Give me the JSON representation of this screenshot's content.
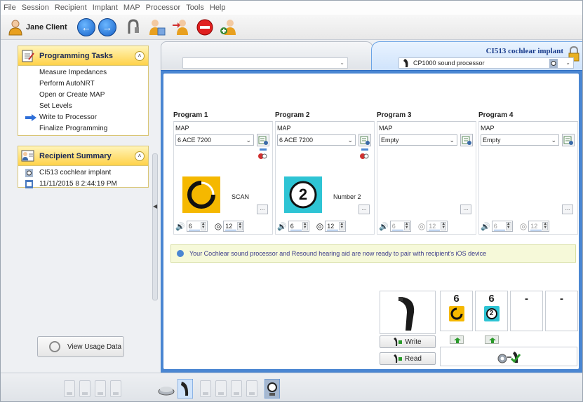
{
  "menu": [
    "File",
    "Session",
    "Recipient",
    "Implant",
    "MAP",
    "Processor",
    "Tools",
    "Help"
  ],
  "toolbar": {
    "client_name": "Jane Client",
    "icons": [
      "person-icon",
      "back-icon",
      "forward-icon",
      "headset-icon",
      "user-check-icon",
      "user-transfer-icon",
      "stop-icon",
      "user-plus-icon"
    ]
  },
  "tasks_panel": {
    "title": "Programming Tasks",
    "items": [
      "Measure Impedances",
      "Perform AutoNRT",
      "Open or Create MAP",
      "Set Levels",
      "Write to Processor",
      "Finalize Programming"
    ],
    "current": "Write to Processor"
  },
  "summary_panel": {
    "title": "Recipient Summary",
    "implant": "CI513 cochlear implant",
    "datetime": "11/11/2015 8 2:44:19 PM"
  },
  "usage_button": "View Usage Data",
  "tabs": {
    "left_combo_value": "",
    "implant_title": "CI513 cochlear implant",
    "processor": "CP1000 sound processor"
  },
  "programs": [
    {
      "title": "Program 1",
      "map_label": "MAP",
      "map": "6 ACE 7200",
      "badge_type": "scan",
      "badge_color": "#f5b800",
      "name": "SCAN",
      "more": "...",
      "volume": "6",
      "sensitivity": "12",
      "enabled": true
    },
    {
      "title": "Program 2",
      "map_label": "MAP",
      "map": "6 ACE 7200",
      "badge_type": "number",
      "badge_text": "2",
      "badge_color": "#2ec4d4",
      "name": "Number 2",
      "more": "...",
      "volume": "6",
      "sensitivity": "12",
      "enabled": true
    },
    {
      "title": "Program 3",
      "map_label": "MAP",
      "map": "Empty",
      "more": "...",
      "volume": "6",
      "sensitivity": "12",
      "enabled": false
    },
    {
      "title": "Program 4",
      "map_label": "MAP",
      "map": "Empty",
      "more": "...",
      "volume": "6",
      "sensitivity": "12",
      "enabled": false
    }
  ],
  "notice": "Your Cochlear sound processor and Resound hearing aid are now ready to pair with recipient's iOS device",
  "processor_slots": [
    {
      "value": "6",
      "badge": "scan"
    },
    {
      "value": "6",
      "badge": "2"
    },
    {
      "value": "-"
    },
    {
      "value": "-"
    }
  ],
  "buttons": {
    "write": "Write",
    "read": "Read"
  },
  "colors": {
    "accent_blue": "#4a86d2",
    "panel_yellow": "#ffd24a",
    "scan_yellow": "#f5b800",
    "program2_cyan": "#2ec4d4"
  }
}
